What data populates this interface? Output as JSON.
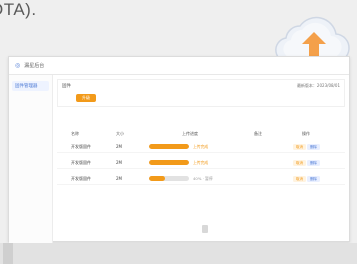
{
  "page": {
    "heading": "OTA)."
  },
  "window": {
    "title": "漏星后台",
    "sidebar": [
      {
        "label": "固件管理器"
      }
    ]
  },
  "card": {
    "title": "固件",
    "right_text": "最新版本：2023/08/01",
    "upgrade_label": "升级"
  },
  "table": {
    "headers": [
      "名称",
      "大小",
      "上传进度",
      "备注",
      "操作"
    ],
    "rows": [
      {
        "name": "开发版固件",
        "size": "2M",
        "progress": 1.0,
        "status": "上传完成",
        "status_type": "ok",
        "action_a": "取消",
        "action_b": "删除"
      },
      {
        "name": "开发版固件",
        "size": "2M",
        "progress": 1.0,
        "status": "上传完成",
        "status_type": "ok",
        "action_a": "取消",
        "action_b": "删除"
      },
      {
        "name": "开发版固件",
        "size": "2M",
        "progress": 0.4,
        "status": "40% · 暂停",
        "status_type": "fail",
        "action_a": "取消",
        "action_b": "删除"
      }
    ]
  },
  "icons": {
    "cloud": "cloud-upload-icon",
    "logo": "app-logo-icon"
  },
  "colors": {
    "accent": "#f29a1a",
    "primary": "#4a78d4",
    "cloud": "#e9eef6",
    "arrow": "#f4a04a"
  }
}
